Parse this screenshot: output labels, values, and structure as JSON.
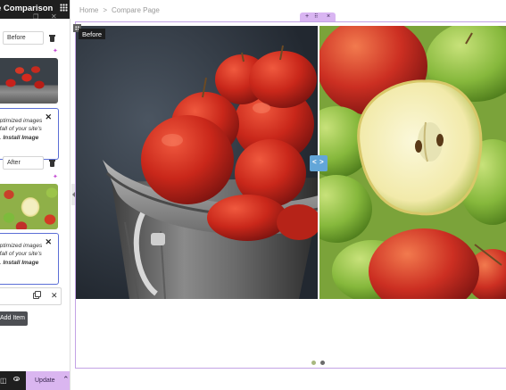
{
  "panel": {
    "title": "e Comparison",
    "items": [
      {
        "label_value": "Before",
        "has_notice": true
      },
      {
        "label_value": "After",
        "has_notice": true
      }
    ],
    "notice": {
      "line1": "optimized images",
      "line2": "nfall of your site's",
      "line3_prefix": "e. ",
      "link": "Install Image"
    },
    "add_item_label": "Add Item",
    "footer": {
      "update_label": "Update"
    }
  },
  "breadcrumb": {
    "home": "Home",
    "separator": ">",
    "current": "Compare Page"
  },
  "section_toolbar": {
    "add": "+",
    "drag": "⠿",
    "close": "×"
  },
  "canvas": {
    "before_label": "Before",
    "slider": {
      "left_arrow": "<",
      "right_arrow": ">",
      "position_fraction": 0.56
    },
    "pagination": {
      "count": 2,
      "active_index": 0
    }
  },
  "colors": {
    "accent": "#d9b5f2",
    "section_outline": "#c3a3e5",
    "slider_handle": "#63a6d8",
    "notice_border": "#5b6fd6",
    "panel_dark": "#1f1f1f",
    "dot_active": "#a8b87f",
    "dot_inactive": "#6b6b6b"
  },
  "icons": {
    "grid": "grid-icon",
    "trash": "trash-icon",
    "sparkle": "sparkle-icon",
    "close": "close-icon",
    "copy": "copy-icon",
    "navigator": "navigator-icon",
    "preview": "eye-icon",
    "chevron": "chevron-up-icon"
  }
}
